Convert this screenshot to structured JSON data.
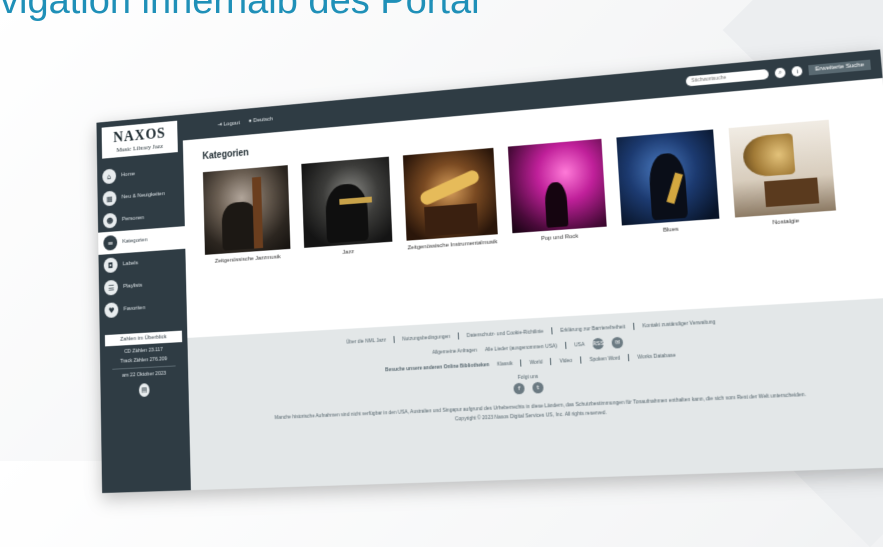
{
  "slide": {
    "title": "vigation innerhalb des Portal"
  },
  "sidebar": {
    "logo_brand": "NAXOS",
    "logo_sub": "Music Library Jazz",
    "items": [
      {
        "label": "Home",
        "icon": "home-icon"
      },
      {
        "label": "Neu & Neuigkeiten",
        "icon": "calendar-icon"
      },
      {
        "label": "Personen",
        "icon": "people-icon"
      },
      {
        "label": "Kategorien",
        "icon": "categories-icon"
      },
      {
        "label": "Labels",
        "icon": "label-icon"
      },
      {
        "label": "Playlists",
        "icon": "playlist-icon"
      },
      {
        "label": "Favoriten",
        "icon": "heart-icon"
      }
    ],
    "overview_button": "Zahlen im Überblick",
    "cd_count": "CD Zählen 23.117",
    "track_count": "Track Zählen 276.209",
    "date": "am 22 Oktober 2023"
  },
  "topbar": {
    "logout": "Logout",
    "language": "Deutsch",
    "search_placeholder": "Stichwortsuche",
    "advanced_search": "Erweiterte Suche"
  },
  "main": {
    "heading": "Kategorien",
    "categories": [
      {
        "label": "Zeitgenössische Jazzmusik"
      },
      {
        "label": "Jazz"
      },
      {
        "label": "Zeitgenössische Instrumentalmusik"
      },
      {
        "label": "Pop und Rock"
      },
      {
        "label": "Blues"
      },
      {
        "label": "Nostalgie"
      }
    ]
  },
  "footer": {
    "links_row1": [
      "Über die NML Jazz",
      "Nutzungsbedingungen",
      "Datenschutz- und Cookie-Richtlinie",
      "Erklärung zur Barrierefreiheit",
      "Kontakt zuständiger Verwaltung"
    ],
    "links_row2": [
      "Allgemeine Anfragen",
      "Alle Lieder (ausgenommen USA)",
      "USA",
      "RSS"
    ],
    "visit_label": "Besuche unsere anderen Online Bibliotheken",
    "libraries": [
      "Klassik",
      "World",
      "Video",
      "Spoken Word",
      "Works Database"
    ],
    "follow_label": "Folgt uns",
    "notice": "Manche historische Aufnahmen sind nicht verfügbar in den USA, Australien und Singapur aufgrund des Urheberrechts in diese Ländern, das Schutzbestimmungen für Tonaufnahmen enthalten kann, die sich vom Rest der Welt unterscheiden.",
    "copyright": "Copyright © 2023 Naxos Digital Services US, Inc. All rights reserved."
  }
}
